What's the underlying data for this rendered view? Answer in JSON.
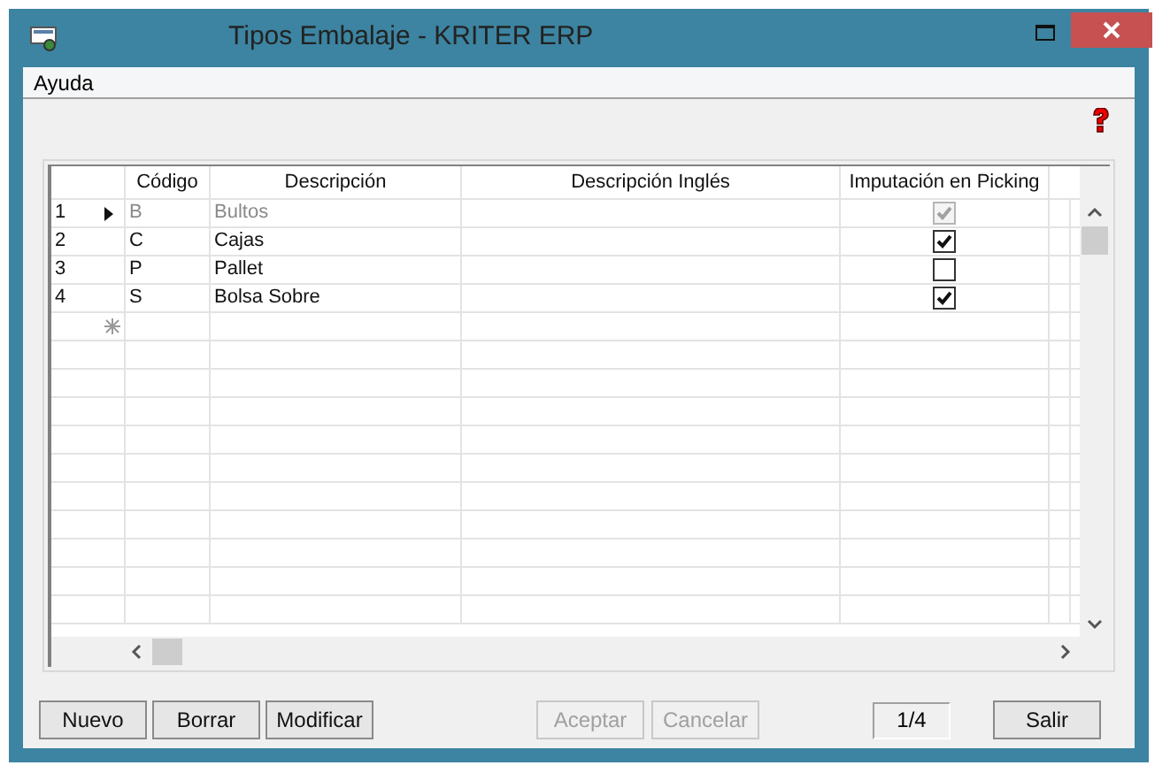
{
  "window": {
    "title": "Tipos Embalaje - KRITER ERP"
  },
  "menu": [
    "Ayuda"
  ],
  "table": {
    "columns": [
      "Código",
      "Descripción",
      "Descripción Inglés",
      "Imputación en Picking"
    ],
    "rows": [
      {
        "number": "1",
        "current": true,
        "codigo": "B",
        "descripcion": "Bultos",
        "picking": true
      },
      {
        "number": "2",
        "current": false,
        "codigo": "C",
        "descripcion": "Cajas",
        "picking": true
      },
      {
        "number": "3",
        "current": false,
        "codigo": "P",
        "descripcion": "Pallet",
        "picking": false
      },
      {
        "number": "4",
        "current": false,
        "codigo": "S",
        "descripcion": "Bolsa Sobre",
        "picking": true
      }
    ]
  },
  "buttons_left": [
    {
      "label": "Nuevo",
      "disabled": false
    },
    {
      "label": "Borrar",
      "disabled": false
    },
    {
      "label": "Modificar",
      "disabled": false
    }
  ],
  "buttons_middle": [
    {
      "label": "Aceptar",
      "disabled": true
    },
    {
      "label": "Cancelar",
      "disabled": true
    }
  ],
  "record_counter": "1/4",
  "exit_button": {
    "label": "Salir",
    "disabled": false
  }
}
